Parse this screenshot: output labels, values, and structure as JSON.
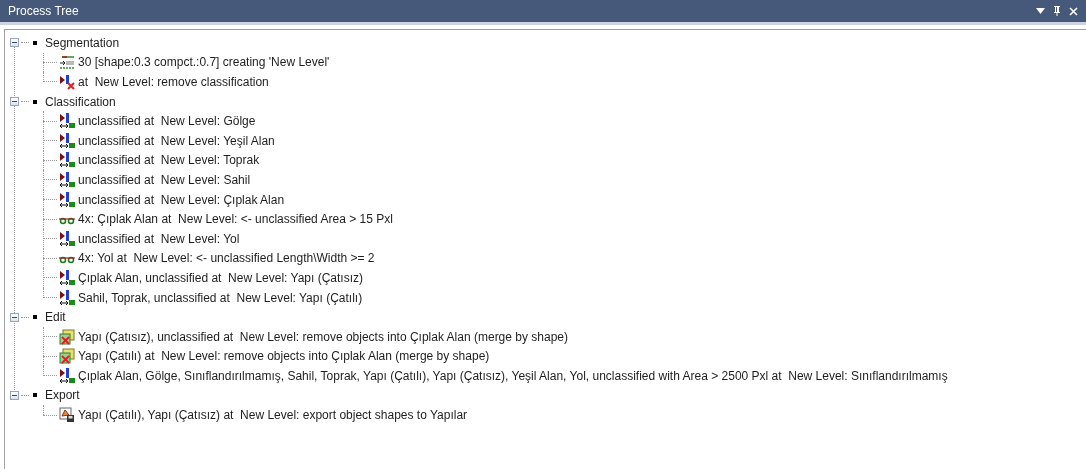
{
  "window": {
    "title": "Process Tree"
  },
  "tree": [
    {
      "label": "Segmentation",
      "expanded": true,
      "children": [
        {
          "kind": "segment",
          "label": "30 [shape:0.3 compct.:0.7] creating 'New Level'"
        },
        {
          "kind": "remove",
          "label": "at  New Level: remove classification"
        }
      ]
    },
    {
      "label": "Classification",
      "expanded": true,
      "children": [
        {
          "kind": "assign",
          "label": "unclassified at  New Level: Gölge"
        },
        {
          "kind": "assign",
          "label": "unclassified at  New Level: Yeşil Alan"
        },
        {
          "kind": "assign",
          "label": "unclassified at  New Level: Toprak"
        },
        {
          "kind": "assign",
          "label": "unclassified at  New Level: Sahil"
        },
        {
          "kind": "assign",
          "label": "unclassified at  New Level: Çıplak Alan"
        },
        {
          "kind": "grow",
          "label": "4x: Çıplak Alan at  New Level: <- unclassified Area > 15 Pxl"
        },
        {
          "kind": "assign",
          "label": "unclassified at  New Level: Yol"
        },
        {
          "kind": "grow",
          "label": "4x: Yol at  New Level: <- unclassified Length\\Width >= 2"
        },
        {
          "kind": "assign",
          "label": "Çıplak Alan, unclassified at  New Level: Yapı (Çatısız)"
        },
        {
          "kind": "assign",
          "label": "Sahil, Toprak, unclassified at  New Level: Yapı (Çatılı)"
        }
      ]
    },
    {
      "label": "Edit",
      "expanded": true,
      "children": [
        {
          "kind": "merge",
          "label": "Yapı (Çatısız), unclassified at  New Level: remove objects into Çıplak Alan (merge by shape)"
        },
        {
          "kind": "merge",
          "label": "Yapı (Çatılı) at  New Level: remove objects into Çıplak Alan (merge by shape)"
        },
        {
          "kind": "assign",
          "label": "Çıplak Alan, Gölge, Sınıflandırılmamış, Sahil, Toprak, Yapı (Çatılı), Yapı (Çatısız), Yeşil Alan, Yol, unclassified with Area > 2500 Pxl at  New Level: Sınıflandırılmamış"
        }
      ]
    },
    {
      "label": "Export",
      "expanded": true,
      "children": [
        {
          "kind": "export",
          "label": "Yapı (Çatılı), Yapı (Çatısız) at  New Level: export object shapes to Yapılar"
        }
      ]
    }
  ]
}
